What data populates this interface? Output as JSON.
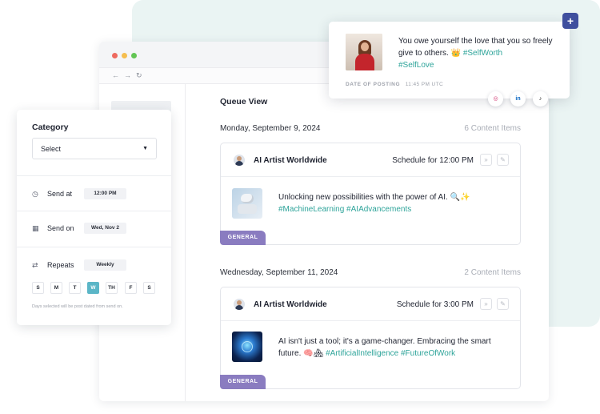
{
  "queue": {
    "title": "Queue View",
    "groups": [
      {
        "date": "Monday, September 9, 2024",
        "count": "6 Content Items",
        "card": {
          "account": "AI Artist Worldwide",
          "schedule": "Schedule for 12:00 PM",
          "text": "Unlocking new possibilities with the power of AI. 🔍✨",
          "tags": "#MachineLearning #AIAdvancements",
          "badge": "GENERAL"
        }
      },
      {
        "date": "Wednesday, September 11, 2024",
        "count": "2 Content Items",
        "card": {
          "account": "AI Artist Worldwide",
          "schedule": "Schedule for 3:00 PM",
          "text": "AI isn't just a tool; it's a game-changer. Embracing the smart future. 🧠🏘",
          "tags": "#ArtificialIntelligence #FutureOfWork",
          "badge": "GENERAL"
        }
      }
    ]
  },
  "category_panel": {
    "title": "Category",
    "select_value": "Select",
    "send_at_label": "Send at",
    "send_at_value": "12:00 PM",
    "send_on_label": "Send on",
    "send_on_value": "Wed, Nov 2",
    "repeats_label": "Repeats",
    "repeats_value": "Weekly",
    "days": [
      "S",
      "M",
      "T",
      "W",
      "TH",
      "F",
      "S"
    ],
    "active_day_index": 3,
    "note": "Days selected will be post dated from send on."
  },
  "social_post": {
    "text": "You owe yourself the love that you so freely give to others. 👑",
    "tags_line1": "#SelfWorth",
    "tags_line2": "#SelfLove",
    "meta_label": "DATE OF POSTING",
    "meta_value": "11:45 PM UTC",
    "networks": [
      "instagram-icon",
      "linkedin-icon",
      "tiktok-icon"
    ]
  },
  "colors": {
    "accent_teal": "#2ea49a",
    "badge_purple": "#8a7cc0",
    "add_button": "#3f4f9e",
    "active_day": "#5bb6c7"
  }
}
